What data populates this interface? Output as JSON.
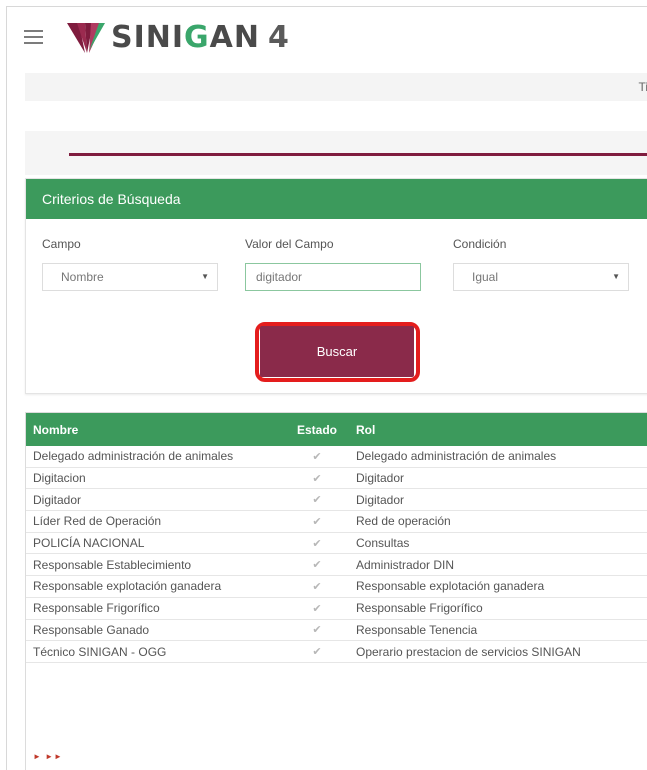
{
  "header": {
    "menu_icon": "hamburger-icon",
    "logo_icon": "sinigan-logo-icon",
    "logo_text_1": "SINI",
    "logo_text_g": "G",
    "logo_text_2": "AN",
    "logo_version": "4",
    "brand_green": "#3aa66b"
  },
  "strip": {
    "text": "Ti"
  },
  "search_panel": {
    "title": "Criterios de Búsqueda",
    "campo": {
      "label": "Campo",
      "value": "Nombre"
    },
    "valor": {
      "label": "Valor del Campo",
      "value": "digitador"
    },
    "condicion": {
      "label": "Condición",
      "value": "Igual"
    },
    "search_button": "Buscar",
    "accent": "#3c9a5c",
    "button_color": "#8a2a4a",
    "highlight_color": "#e41d1d"
  },
  "results": {
    "columns": [
      "Nombre",
      "Estado",
      "Rol"
    ],
    "rows": [
      {
        "nombre": "Delegado administración de animales",
        "estado": "✔",
        "rol": "Delegado administración de animales"
      },
      {
        "nombre": "Digitacion",
        "estado": "✔",
        "rol": "Digitador"
      },
      {
        "nombre": "Digitador",
        "estado": "✔",
        "rol": "Digitador"
      },
      {
        "nombre": "Líder Red de Operación",
        "estado": "✔",
        "rol": "Red de operación"
      },
      {
        "nombre": "POLICÍA NACIONAL",
        "estado": "✔",
        "rol": "Consultas"
      },
      {
        "nombre": "Responsable Establecimiento",
        "estado": "✔",
        "rol": "Administrador DIN"
      },
      {
        "nombre": "Responsable explotación ganadera",
        "estado": "✔",
        "rol": "Responsable explotación ganadera"
      },
      {
        "nombre": "Responsable Frigorífico",
        "estado": "✔",
        "rol": "Responsable Frigorífico"
      },
      {
        "nombre": "Responsable Ganado",
        "estado": "✔",
        "rol": "Responsable Tenencia"
      },
      {
        "nombre": "Técnico SINIGAN - OGG",
        "estado": "✔",
        "rol": "Operario prestacion de servicios SINIGAN"
      }
    ],
    "pager": "► ►►"
  }
}
